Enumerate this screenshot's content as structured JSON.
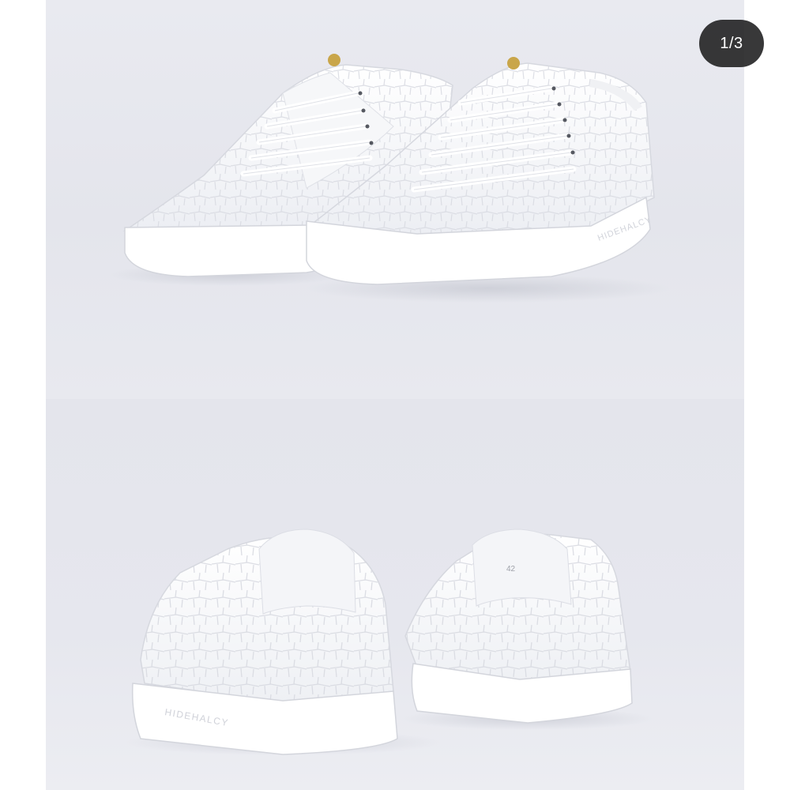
{
  "gallery": {
    "counter": "1/3",
    "photos": [
      {
        "label": "HIDEHALCY",
        "color": "#ffffff"
      },
      {
        "label": "HIDEHALCY",
        "size_label": "42"
      }
    ]
  },
  "colors": {
    "background": "#ffffff",
    "badge": "#1c1c1e",
    "backdrop": "#e6e7ed",
    "shoe": "#fbfbfc",
    "eyelet": "#c9a64a"
  }
}
